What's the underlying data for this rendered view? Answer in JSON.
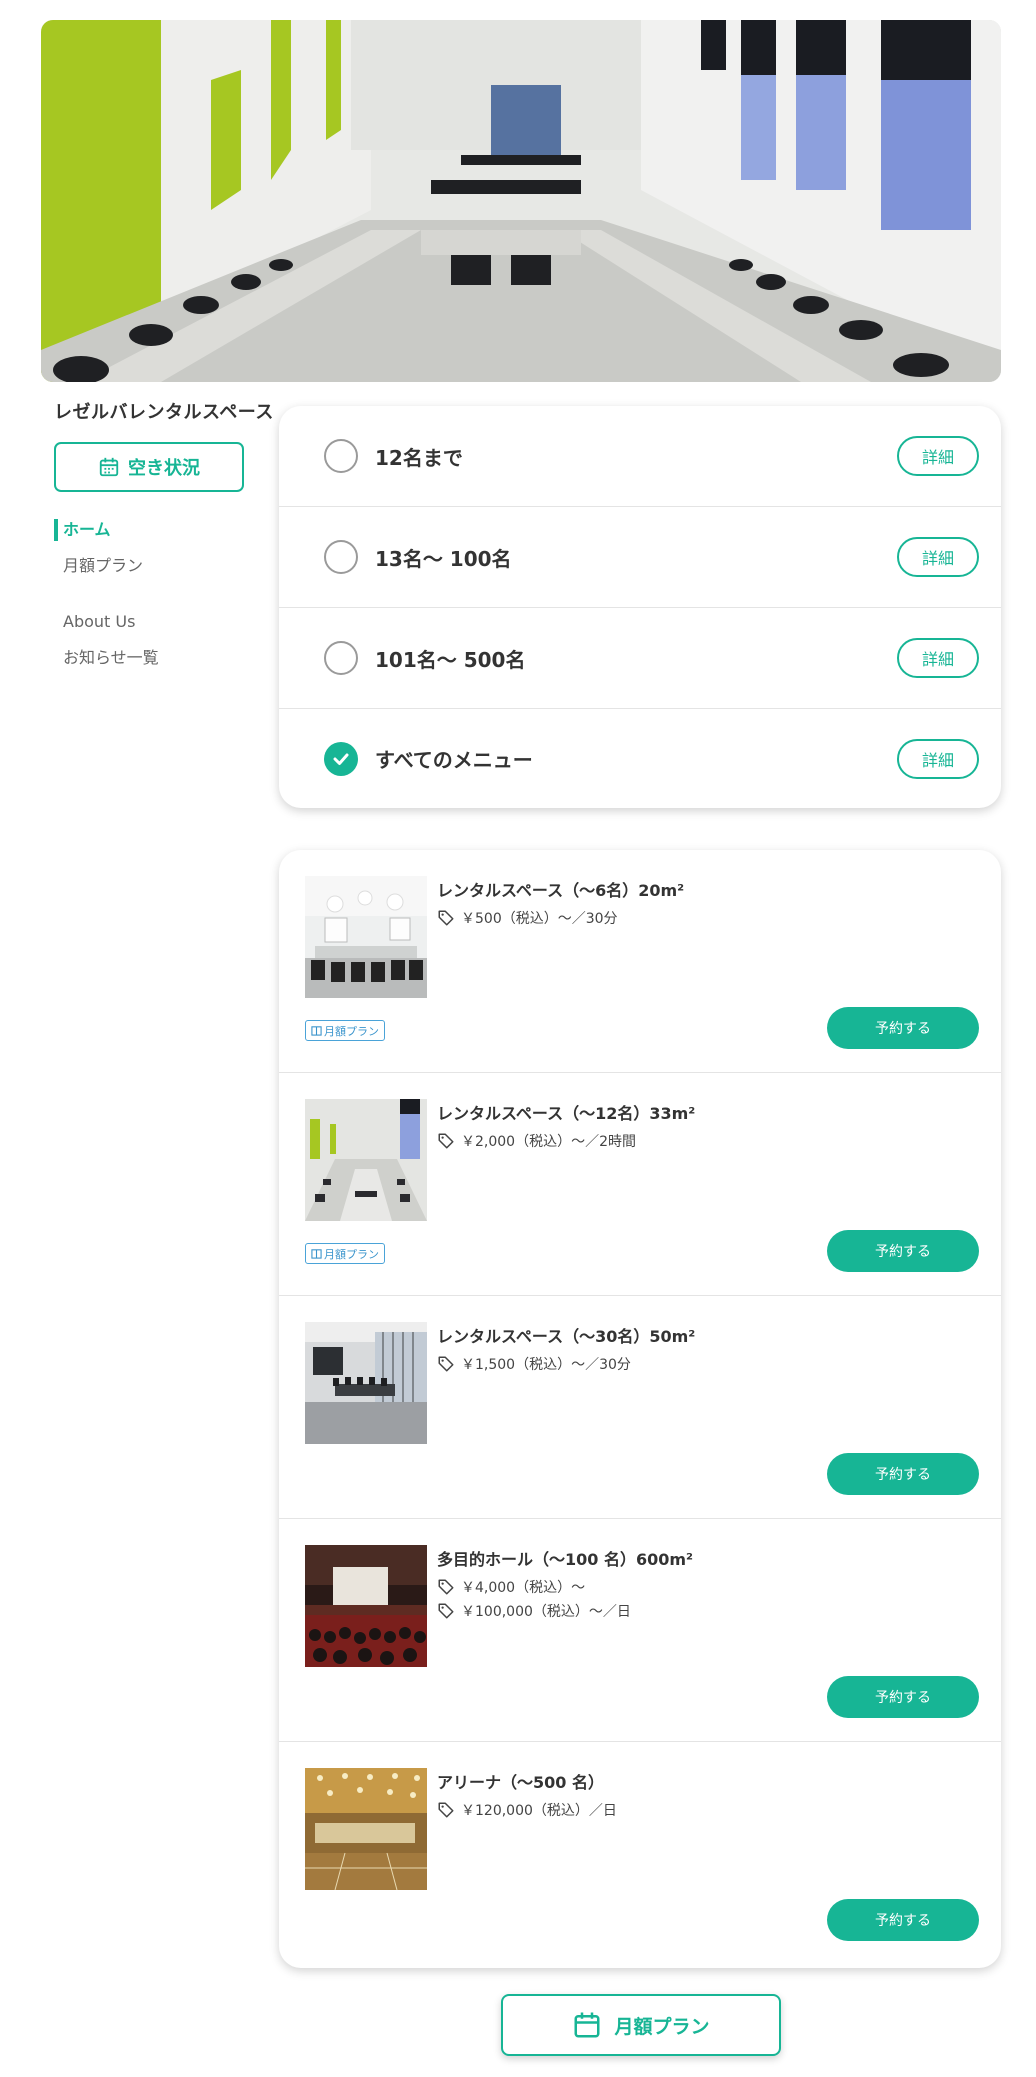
{
  "site": {
    "name": "レゼルバレンタルスペース"
  },
  "sidebar": {
    "availability_button": "空き状況",
    "nav_primary": [
      {
        "label": "ホーム",
        "active": true
      },
      {
        "label": "月額プラン",
        "active": false
      }
    ],
    "nav_secondary": [
      {
        "label": "About Us"
      },
      {
        "label": "お知らせ一覧"
      }
    ]
  },
  "filters": [
    {
      "label": "12名まで",
      "checked": false,
      "detail_label": "詳細"
    },
    {
      "label": "13名～ 100名",
      "checked": false,
      "detail_label": "詳細"
    },
    {
      "label": "101名～ 500名",
      "checked": false,
      "detail_label": "詳細"
    },
    {
      "label": "すべてのメニュー",
      "checked": true,
      "detail_label": "詳細"
    }
  ],
  "spaces": [
    {
      "title": "レンタルスペース（～6名）20m²",
      "prices": [
        "￥500（税込）～／30分"
      ],
      "badge": "月額プラン",
      "reserve_label": "予約する"
    },
    {
      "title": "レンタルスペース（～12名）33m²",
      "prices": [
        "￥2,000（税込）～／2時間"
      ],
      "badge": "月額プラン",
      "reserve_label": "予約する"
    },
    {
      "title": "レンタルスペース（～30名）50m²",
      "prices": [
        "￥1,500（税込）～／30分"
      ],
      "badge": "",
      "reserve_label": "予約する"
    },
    {
      "title": "多目的ホール（～100 名）600m²",
      "prices": [
        "￥4,000（税込）～",
        "￥100,000（税込）～／日"
      ],
      "badge": "",
      "reserve_label": "予約する"
    },
    {
      "title": "アリーナ（～500 名）",
      "prices": [
        "￥120,000（税込）／日"
      ],
      "badge": "",
      "reserve_label": "予約する"
    }
  ],
  "bottom": {
    "plan_button": "月額プラン"
  },
  "colors": {
    "accent": "#17b595",
    "badge": "#3a94cc",
    "text": "#333333"
  }
}
